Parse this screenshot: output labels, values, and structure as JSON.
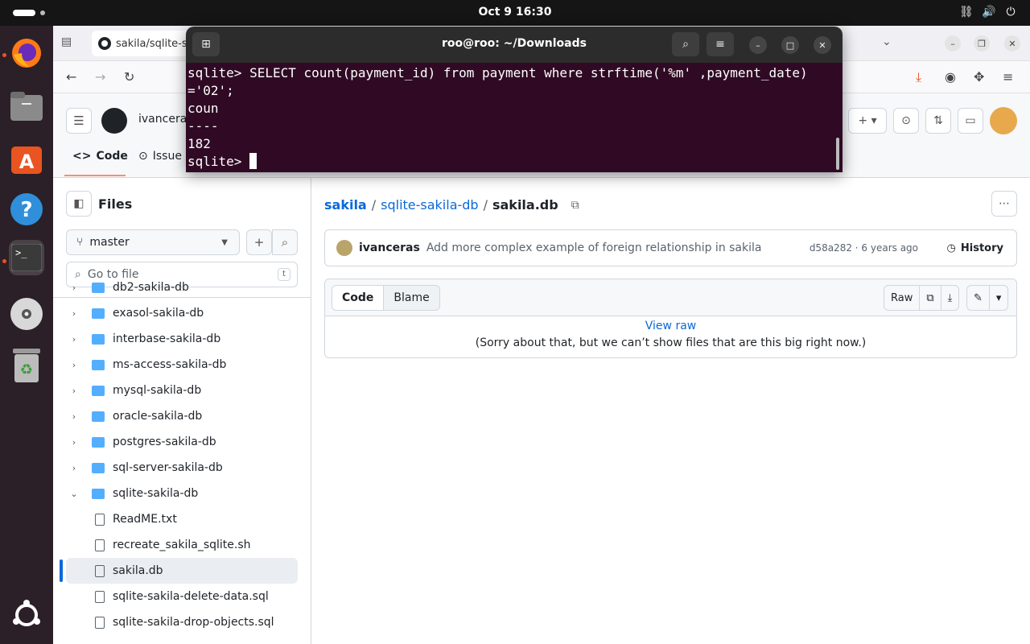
{
  "topbar": {
    "clock": "Oct 9  16:30"
  },
  "browser": {
    "tab_title": "sakila/sqlite-s",
    "tab_icons": {
      "list": "tab-list-icon",
      "favicon": "github-icon"
    }
  },
  "github": {
    "owner": "ivanceras",
    "tabs": [
      {
        "label": "Code"
      },
      {
        "label": "Issue"
      }
    ]
  },
  "sidebar": {
    "title": "Files",
    "branch": "master",
    "search_placeholder": "Go to file",
    "search_shortcut": "t",
    "tree": [
      {
        "label": "db2-sakila-db",
        "type": "folder",
        "expanded": false
      },
      {
        "label": "exasol-sakila-db",
        "type": "folder",
        "expanded": false
      },
      {
        "label": "interbase-sakila-db",
        "type": "folder",
        "expanded": false
      },
      {
        "label": "ms-access-sakila-db",
        "type": "folder",
        "expanded": false
      },
      {
        "label": "mysql-sakila-db",
        "type": "folder",
        "expanded": false
      },
      {
        "label": "oracle-sakila-db",
        "type": "folder",
        "expanded": false
      },
      {
        "label": "postgres-sakila-db",
        "type": "folder",
        "expanded": false
      },
      {
        "label": "sql-server-sakila-db",
        "type": "folder",
        "expanded": false
      },
      {
        "label": "sqlite-sakila-db",
        "type": "folder",
        "expanded": true
      },
      {
        "label": "ReadME.txt",
        "type": "file"
      },
      {
        "label": "recreate_sakila_sqlite.sh",
        "type": "file"
      },
      {
        "label": "sakila.db",
        "type": "file",
        "selected": true
      },
      {
        "label": "sqlite-sakila-delete-data.sql",
        "type": "file"
      },
      {
        "label": "sqlite-sakila-drop-objects.sql",
        "type": "file"
      }
    ]
  },
  "main": {
    "breadcrumb": {
      "repo": "sakila",
      "folder": "sqlite-sakila-db",
      "file": "sakila.db",
      "sep": "/"
    },
    "commit": {
      "author": "ivanceras",
      "message": "Add more complex example of foreign relationship in sakila",
      "meta": "d58a282 · 6 years ago",
      "history_label": "History"
    },
    "file": {
      "tab_code": "Code",
      "tab_blame": "Blame",
      "raw_label": "Raw",
      "view_raw": "View raw",
      "notice": "(Sorry about that, but we can’t show files that are this big right now.)"
    }
  },
  "terminal": {
    "title": "roo@roo: ~/Downloads",
    "lines": [
      "sqlite> SELECT count(payment_id) from payment where strftime('%m' ,payment_date)",
      "='02';",
      "coun",
      "----",
      "182"
    ],
    "prompt": "sqlite> "
  },
  "colors": {
    "accent": "#0969da",
    "terminal_bg": "#300a24",
    "dock_bg": "#2b2027",
    "ubuntu_orange": "#e95420"
  }
}
